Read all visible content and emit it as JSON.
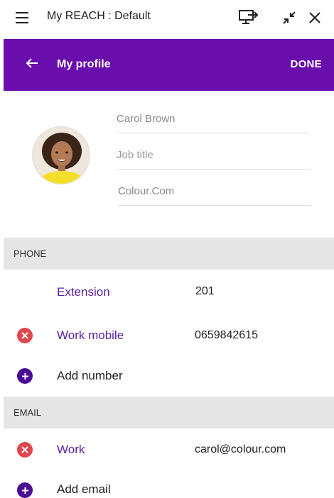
{
  "titlebar": {
    "app_title": "My REACH : Default",
    "icons": [
      "menu-icon",
      "cast-screen-icon",
      "minimize-icon",
      "close-icon"
    ]
  },
  "header": {
    "title": "My profile",
    "done_label": "DONE",
    "background_color": "#6a0dad"
  },
  "profile": {
    "name_value": "Carol Brown",
    "job_title_placeholder": "Job title",
    "company_value": "Colour.Com"
  },
  "phone": {
    "section_label": "PHONE",
    "extension_label": "Extension",
    "extension_value": "201",
    "work_mobile_label": "Work mobile",
    "work_mobile_value": "0659842615",
    "add_label": "Add number"
  },
  "email": {
    "section_label": "EMAIL",
    "work_label": "Work",
    "work_value": "carol@colour.com",
    "add_label": "Add email"
  },
  "colors": {
    "accent": "#6a0dad",
    "remove": "#e0474c",
    "add": "#4b0a96",
    "label": "#5b1f9e"
  }
}
